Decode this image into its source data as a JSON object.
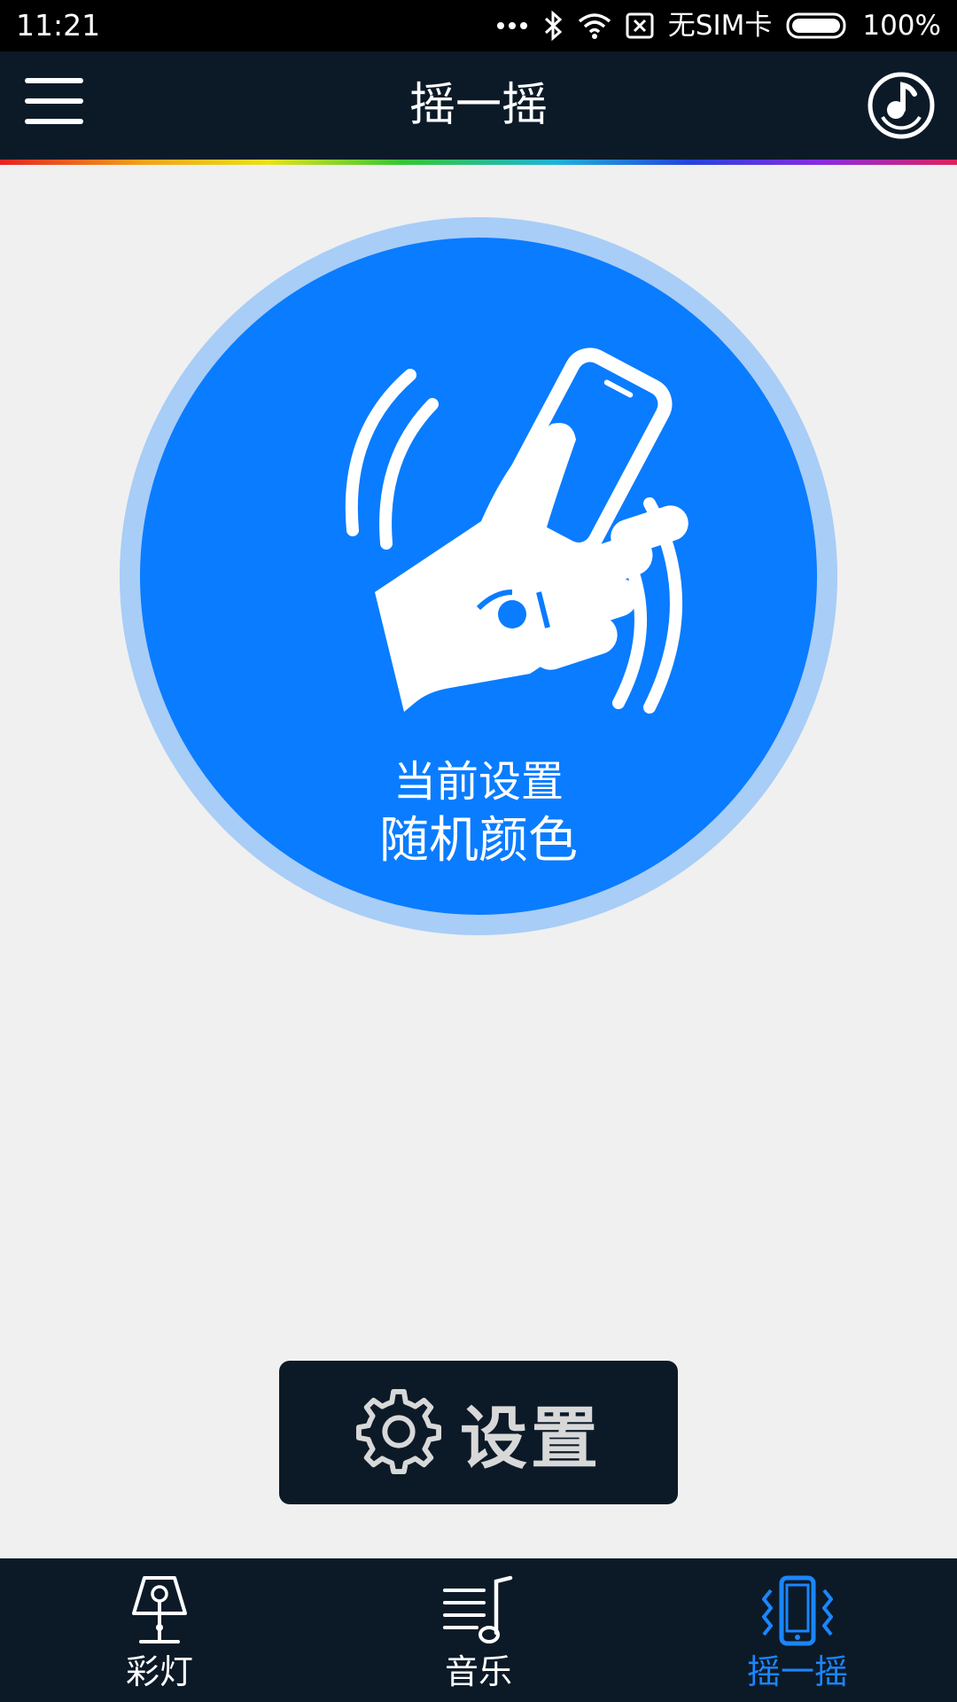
{
  "status_bar": {
    "time": "11:21",
    "sim_status": "无SIM卡",
    "battery_percent": "100%"
  },
  "header": {
    "title": "摇一摇",
    "menu_icon": "hamburger-menu-icon",
    "music_icon": "music-disc-icon"
  },
  "shake": {
    "setting_label": "当前设置",
    "setting_value": "随机颜色",
    "illustration": "hand-shaking-phone-icon"
  },
  "settings_button": {
    "label": "设置",
    "icon": "gear-icon"
  },
  "bottom_nav": {
    "items": [
      {
        "label": "彩灯",
        "icon": "lamp-icon",
        "active": false
      },
      {
        "label": "音乐",
        "icon": "music-note-icon",
        "active": false
      },
      {
        "label": "摇一摇",
        "icon": "shake-phone-icon",
        "active": true
      }
    ]
  },
  "colors": {
    "header_bg": "#0c1a28",
    "circle_blue": "#0a7cff",
    "circle_ring": "#a8cdf7",
    "active_nav": "#1a86ff",
    "page_bg": "#f0f0f0"
  }
}
